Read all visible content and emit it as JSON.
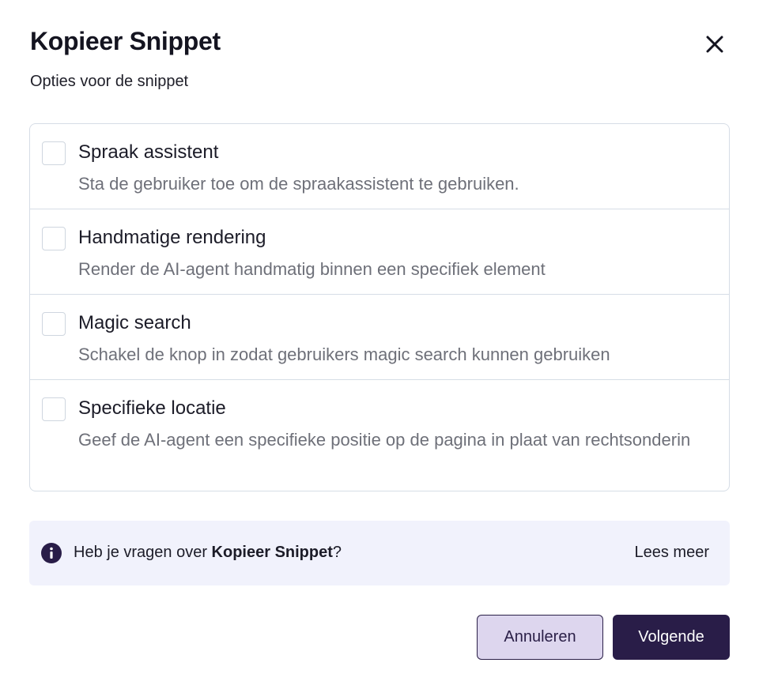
{
  "dialog": {
    "title": "Kopieer Snippet",
    "subtitle": "Opties voor de snippet",
    "close_icon": "close-icon"
  },
  "options": [
    {
      "label": "Spraak assistent",
      "description": "Sta de gebruiker toe om de spraakassistent te gebruiken.",
      "checked": false
    },
    {
      "label": "Handmatige rendering",
      "description": "Render de AI-agent handmatig binnen een specifiek element",
      "checked": false
    },
    {
      "label": "Magic search",
      "description": "Schakel de knop in zodat gebruikers magic search kunnen gebruiken",
      "checked": false
    },
    {
      "label": "Specifieke locatie",
      "description": "Geef de AI-agent een specifieke positie op de pagina in plaat van rechtsonderin",
      "checked": false
    }
  ],
  "info": {
    "icon": "info-icon",
    "text_before": "Heb je vragen over ",
    "text_bold": "Kopieer Snippet",
    "text_after": "?",
    "link": "Lees meer"
  },
  "footer": {
    "cancel_label": "Annuleren",
    "next_label": "Volgende"
  },
  "colors": {
    "primary": "#291d48",
    "secondary_bg": "#ddd6ee",
    "info_bg": "#f1f2fc",
    "border": "#d6dde6"
  }
}
